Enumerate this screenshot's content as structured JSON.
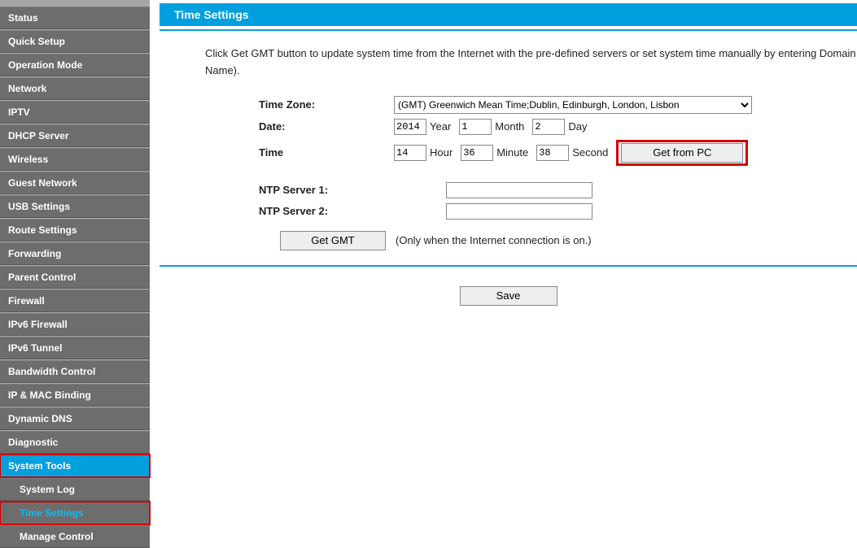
{
  "sidebar": {
    "items": [
      {
        "label": "Status"
      },
      {
        "label": "Quick Setup"
      },
      {
        "label": "Operation Mode"
      },
      {
        "label": "Network"
      },
      {
        "label": "IPTV"
      },
      {
        "label": "DHCP Server"
      },
      {
        "label": "Wireless"
      },
      {
        "label": "Guest Network"
      },
      {
        "label": "USB Settings"
      },
      {
        "label": "Route Settings"
      },
      {
        "label": "Forwarding"
      },
      {
        "label": "Parent Control"
      },
      {
        "label": "Firewall"
      },
      {
        "label": "IPv6 Firewall"
      },
      {
        "label": "IPv6 Tunnel"
      },
      {
        "label": "Bandwidth Control"
      },
      {
        "label": "IP & MAC Binding"
      },
      {
        "label": "Dynamic DNS"
      },
      {
        "label": "Diagnostic"
      },
      {
        "label": "System Tools"
      }
    ],
    "subs": [
      {
        "label": "System Log"
      },
      {
        "label": "Time Settings"
      },
      {
        "label": "Manage Control"
      }
    ]
  },
  "panel": {
    "title": "Time Settings",
    "description": "Click Get GMT button to update system time from the Internet with the pre-defined servers or set system time manually by entering Domain Name).",
    "labels": {
      "timezone": "Time Zone:",
      "date": "Date:",
      "time": "Time",
      "ntp1": "NTP Server 1:",
      "ntp2": "NTP Server 2:"
    },
    "timezone_value": "(GMT) Greenwich Mean Time;Dublin, Edinburgh, London, Lisbon",
    "date": {
      "year": "2014",
      "year_unit": "Year",
      "month": "1",
      "month_unit": "Month",
      "day": "2",
      "day_unit": "Day"
    },
    "time": {
      "hour": "14",
      "hour_unit": "Hour",
      "minute": "36",
      "minute_unit": "Minute",
      "second": "38",
      "second_unit": "Second"
    },
    "ntp1": "",
    "ntp2": "",
    "buttons": {
      "get_from_pc": "Get from PC",
      "get_gmt": "Get GMT",
      "save": "Save"
    },
    "gmt_note": "(Only when the Internet connection is on.)"
  }
}
